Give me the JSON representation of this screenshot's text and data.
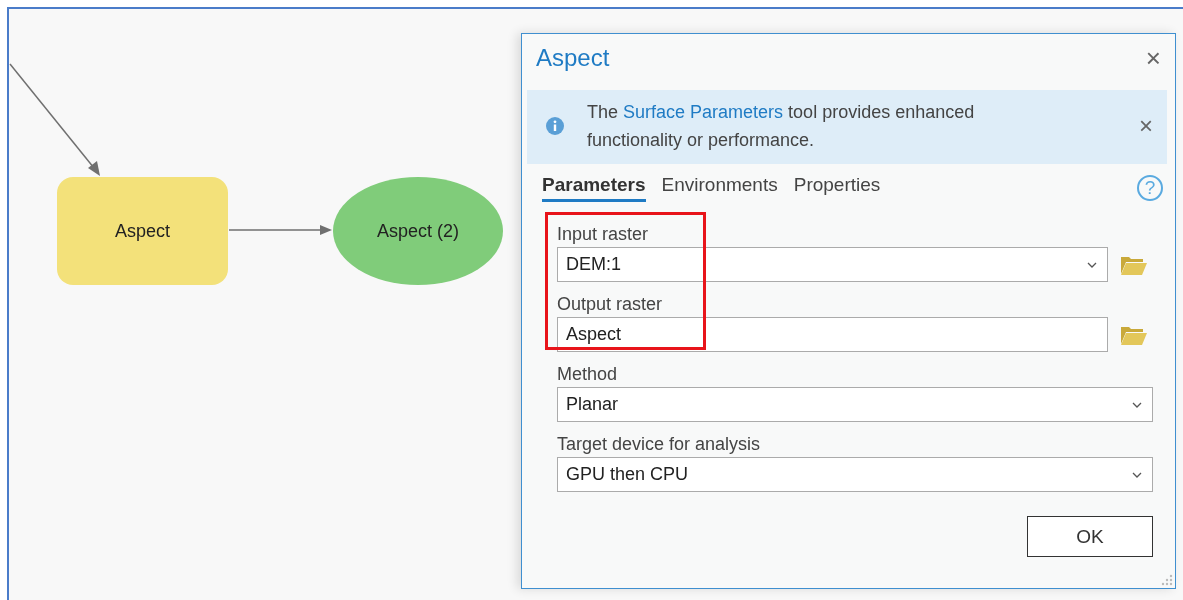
{
  "diagram": {
    "nodes": [
      {
        "kind": "process",
        "label": "Aspect"
      },
      {
        "kind": "output",
        "label": "Aspect (2)"
      }
    ]
  },
  "dialog": {
    "title": "Aspect",
    "close": "×",
    "banner": {
      "before": "The ",
      "link": "Surface Parameters",
      "after": " tool provides enhanced functionality or performance.",
      "close": "×"
    },
    "tabs": [
      {
        "label": "Parameters",
        "selected": true
      },
      {
        "label": "Environments",
        "selected": false
      },
      {
        "label": "Properties",
        "selected": false
      }
    ],
    "help": "?",
    "fields": [
      {
        "label": "Input raster",
        "value": "DEM:1",
        "kind": "dropdown",
        "browse": true
      },
      {
        "label": "Output raster",
        "value": "Aspect",
        "kind": "text",
        "browse": true
      },
      {
        "label": "Method",
        "value": "Planar",
        "kind": "dropdown",
        "browse": false
      },
      {
        "label": "Target device for analysis",
        "value": "GPU then CPU",
        "kind": "dropdown",
        "browse": false
      }
    ],
    "ok": "OK"
  }
}
